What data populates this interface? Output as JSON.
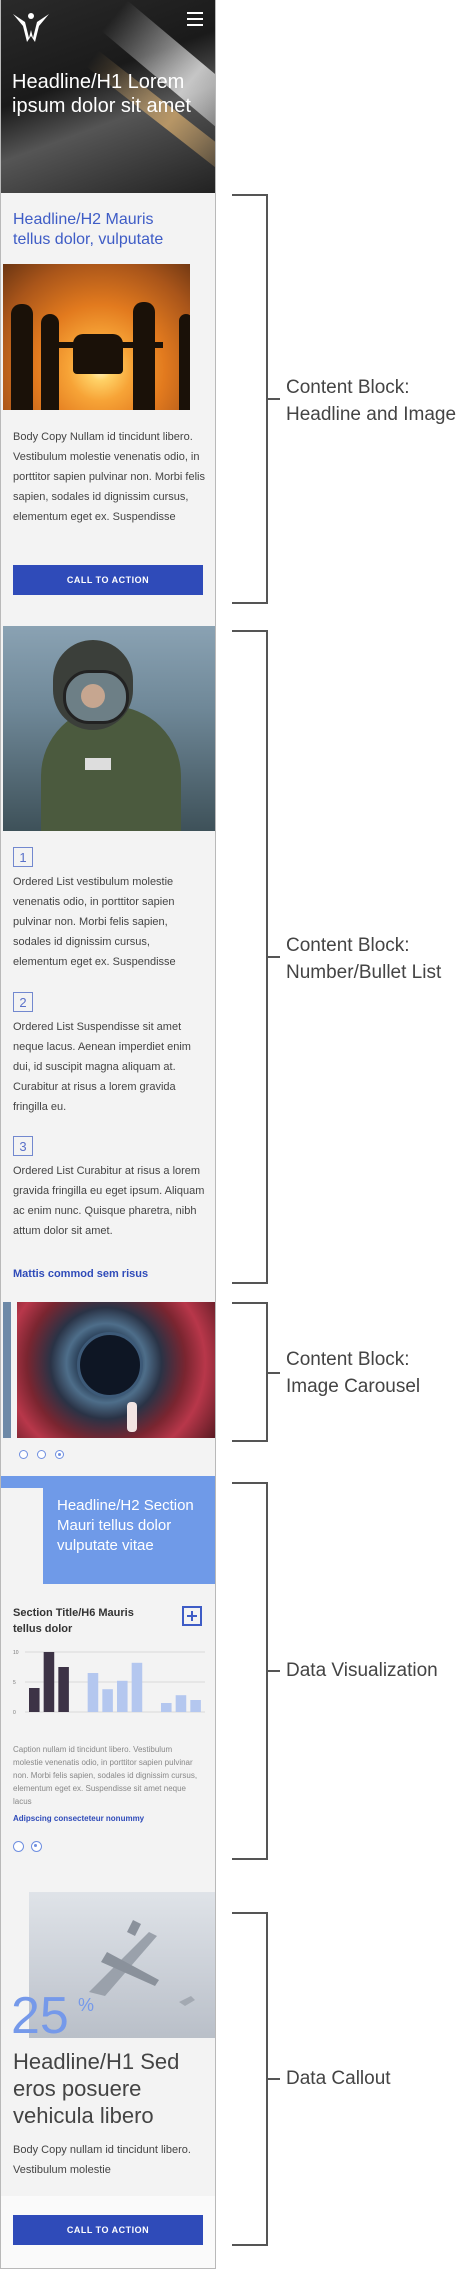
{
  "hero": {
    "title": "Headline/H1 Lorem ipsum dolor sit amet",
    "logo_icon": "air-force-logo",
    "menu_icon": "hamburger-menu-icon"
  },
  "block1": {
    "headline": "Headline/H2 Mauris tellus dolor, vulputate",
    "body": "Body Copy Nullam id tincidunt libero. Vestibulum molestie venenatis odio, in porttitor sapien pulvinar non. Morbi felis sapien, sodales id dignissim cursus, elementum eget ex. Suspendisse",
    "cta": "CALL TO ACTION"
  },
  "block2": {
    "items": [
      {
        "number": "1",
        "text": "Ordered List vestibulum molestie venenatis odio, in porttitor sapien pulvinar non. Morbi felis sapien, sodales id dignissim cursus, elementum eget ex. Suspendisse"
      },
      {
        "number": "2",
        "text": "Ordered List Suspendisse sit amet neque lacus. Aenean imperdiet enim dui, id suscipit magna aliquam at. Curabitur at risus a lorem gravida fringilla eu."
      },
      {
        "number": "3",
        "text": "Ordered List Curabitur at risus a lorem gravida fringilla eu eget ipsum. Aliquam ac enim nunc. Quisque pharetra, nibh attum dolor sit amet."
      }
    ],
    "link": "Mattis commod sem risus"
  },
  "carousel": {
    "dots": [
      false,
      false,
      true
    ]
  },
  "dataviz": {
    "headline": "Headline/H2 Section Mauri tellus dolor vulputate vitae",
    "section_title": "Section Title/H6 Mauris tellus dolor",
    "caption": "Caption nullam id tincidunt libero. Vestibulum molestie venenatis odio, in porttitor sapien pulvinar non. Morbi felis sapien, sodales id dignissim cursus, elementum eget ex. Suspendisse sit amet neque lacus",
    "link": "Adipscing consecteteur nonummy",
    "dots": [
      false,
      true
    ]
  },
  "chart_data": {
    "type": "bar",
    "title": "",
    "xlabel": "",
    "ylabel": "",
    "ylim": [
      0,
      10
    ],
    "y_ticks": [
      "10",
      "5",
      "0"
    ],
    "grid": true,
    "colors": [
      "#3d3346",
      "#b4c7ef"
    ],
    "values": [
      4,
      10,
      7.5,
      0,
      6.5,
      3.8,
      5.2,
      8.2,
      0,
      1.5,
      2.8,
      2
    ]
  },
  "callout": {
    "number": "25",
    "unit": "%",
    "headline": "Headline/H1 Sed eros posuere vehicula libero",
    "body": "Body Copy nullam id tincidunt libero. Vestibulum molestie",
    "cta": "CALL TO ACTION"
  },
  "annotations": [
    {
      "line1": "Content Block:",
      "line2": "Headline and Image"
    },
    {
      "line1": "Content Block:",
      "line2": "Number/Bullet List"
    },
    {
      "line1": "Content Block:",
      "line2": "Image Carousel"
    },
    {
      "line1": "Data Visualization",
      "line2": ""
    },
    {
      "line1": "Data Callout",
      "line2": ""
    }
  ]
}
